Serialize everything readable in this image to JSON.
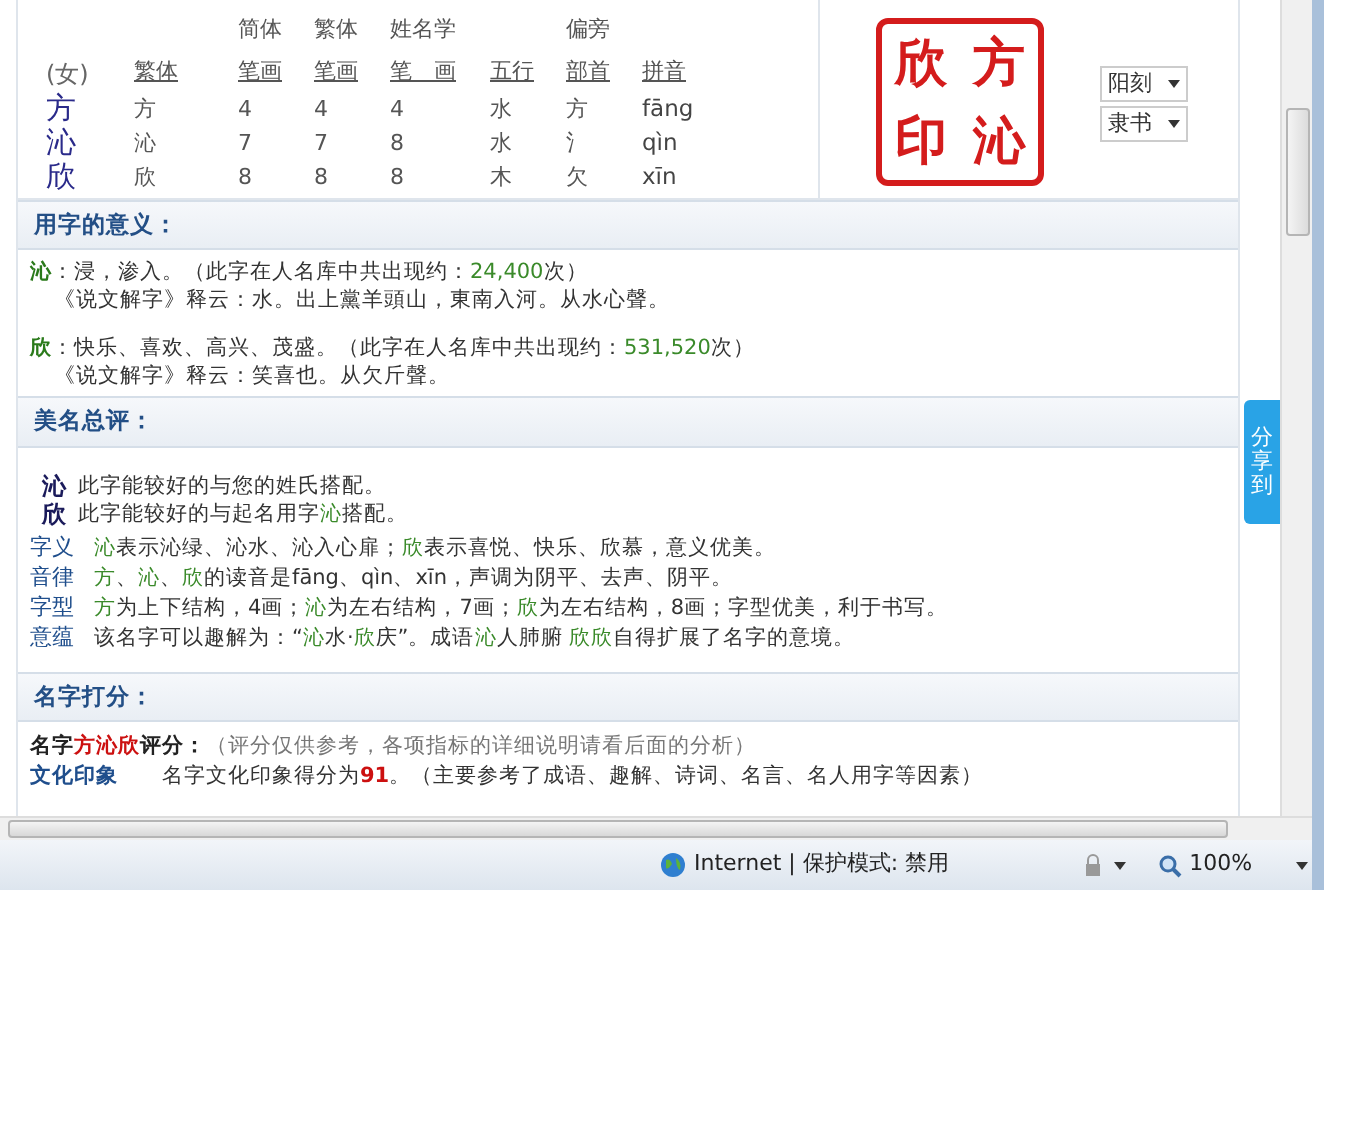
{
  "char_table": {
    "gender": "(女)",
    "columns": [
      {
        "bottom": "繁体"
      },
      {
        "top": "简体",
        "bottom": "笔画"
      },
      {
        "top": "繁体",
        "bottom": "笔画"
      },
      {
        "top": "姓名学",
        "bottom": "笔　画"
      },
      {
        "bottom": "五行"
      },
      {
        "top": "偏旁",
        "bottom": "部首"
      },
      {
        "bottom": "拼音"
      }
    ],
    "rows": [
      {
        "char": "方",
        "cells": [
          "方",
          "4",
          "4",
          "4",
          "水",
          "方",
          "fāng"
        ]
      },
      {
        "char": "沁",
        "cells": [
          "沁",
          "7",
          "7",
          "8",
          "水",
          "氵",
          "qìn"
        ]
      },
      {
        "char": "欣",
        "cells": [
          "欣",
          "8",
          "8",
          "8",
          "木",
          "欠",
          "xīn"
        ]
      }
    ]
  },
  "seal": {
    "chars": [
      "欣",
      "方",
      "印",
      "沁"
    ],
    "selects": [
      "阳刻",
      "隶书"
    ]
  },
  "share_tab": "分享到",
  "meaning": {
    "title": "用字的意义：",
    "entries": [
      {
        "char": "沁",
        "line1": [
          {
            "kind": "plain",
            "text": "：浸，渗入。（此字在人名库中共出现约："
          },
          {
            "kind": "green",
            "text": "24,400"
          },
          {
            "kind": "plain",
            "text": "次）"
          }
        ],
        "line2": "《说文解字》释云：水。出上黨羊頭山，東南入河。从水心聲。"
      },
      {
        "char": "欣",
        "line1": [
          {
            "kind": "plain",
            "text": "：快乐、喜欢、高兴、茂盛。（此字在人名库中共出现约："
          },
          {
            "kind": "green",
            "text": "531,520"
          },
          {
            "kind": "plain",
            "text": "次）"
          }
        ],
        "line2": "《说文解字》释云：笑喜也。从欠斤聲。"
      }
    ]
  },
  "review": {
    "title": "美名总评：",
    "matches": [
      {
        "char": "沁",
        "segments": [
          {
            "kind": "plain",
            "text": "此字能较好的与您的姓氏搭配。"
          }
        ]
      },
      {
        "char": "欣",
        "segments": [
          {
            "kind": "plain",
            "text": "此字能较好的与起名用字"
          },
          {
            "kind": "green",
            "text": "沁"
          },
          {
            "kind": "plain",
            "text": "搭配。"
          }
        ]
      }
    ],
    "aspects": [
      {
        "label": "字义",
        "segments": [
          {
            "kind": "green",
            "text": "沁"
          },
          {
            "kind": "plain",
            "text": "表示沁绿、沁水、沁入心扉；"
          },
          {
            "kind": "green",
            "text": "欣"
          },
          {
            "kind": "plain",
            "text": "表示喜悦、快乐、欣慕，意义优美。"
          }
        ]
      },
      {
        "label": "音律",
        "segments": [
          {
            "kind": "green",
            "text": "方"
          },
          {
            "kind": "plain",
            "text": "、"
          },
          {
            "kind": "green",
            "text": "沁"
          },
          {
            "kind": "plain",
            "text": "、"
          },
          {
            "kind": "green",
            "text": "欣"
          },
          {
            "kind": "plain",
            "text": "的读音是fāng、qìn、xīn，声调为阴平、去声、阴平。"
          }
        ]
      },
      {
        "label": "字型",
        "segments": [
          {
            "kind": "green",
            "text": "方"
          },
          {
            "kind": "plain",
            "text": "为上下结构，4画；"
          },
          {
            "kind": "green",
            "text": "沁"
          },
          {
            "kind": "plain",
            "text": "为左右结构，7画；"
          },
          {
            "kind": "green",
            "text": "欣"
          },
          {
            "kind": "plain",
            "text": "为左右结构，8画；字型优美，利于书写。"
          }
        ]
      },
      {
        "label": "意蕴",
        "segments": [
          {
            "kind": "plain",
            "text": "该名字可以趣解为：“"
          },
          {
            "kind": "green",
            "text": "沁"
          },
          {
            "kind": "plain",
            "text": "水·"
          },
          {
            "kind": "green",
            "text": "欣"
          },
          {
            "kind": "plain",
            "text": "庆”。成语"
          },
          {
            "kind": "green",
            "text": "沁"
          },
          {
            "kind": "plain",
            "text": "人肺腑 "
          },
          {
            "kind": "green",
            "text": "欣欣"
          },
          {
            "kind": "plain",
            "text": "自得扩展了名字的意境。"
          }
        ]
      }
    ]
  },
  "score": {
    "title": "名字打分：",
    "heading": [
      {
        "kind": "bold",
        "text": "名字"
      },
      {
        "kind": "red",
        "text": "方沁欣"
      },
      {
        "kind": "bold",
        "text": "评分："
      },
      {
        "kind": "grey",
        "text": "（评分仅供参考，各项指标的详细说明请看后面的分析）"
      }
    ],
    "items": [
      {
        "label": "文化印象",
        "segments": [
          {
            "kind": "plain",
            "text": "名字文化印象得分为"
          },
          {
            "kind": "red",
            "text": "91"
          },
          {
            "kind": "plain",
            "text": "。（主要参考了成语、趣解、诗词、名言、名人用字等因素）"
          }
        ]
      }
    ]
  },
  "status_bar": {
    "zone": "Internet | 保护模式: 禁用",
    "zoom": "100%"
  }
}
